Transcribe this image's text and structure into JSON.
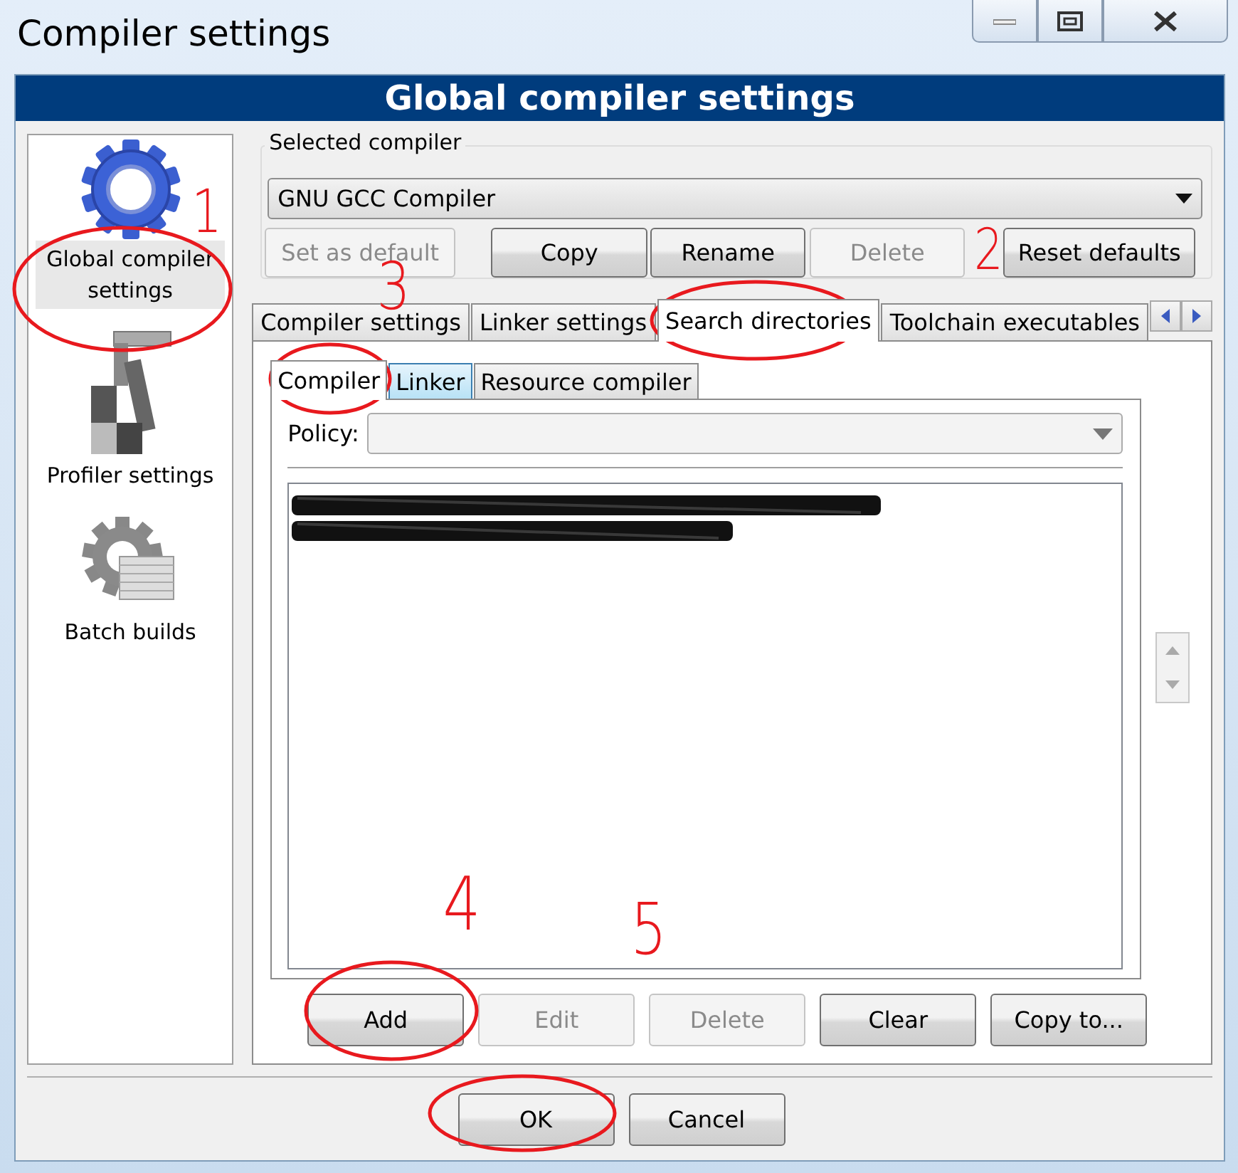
{
  "window": {
    "title": "Compiler settings"
  },
  "header": "Global compiler settings",
  "sidebar": {
    "items": [
      {
        "label": "Global compiler settings",
        "kind": "gear",
        "selected": true
      },
      {
        "label": "Profiler settings",
        "kind": "profiler",
        "selected": false
      },
      {
        "label": "Batch builds",
        "kind": "batch",
        "selected": false
      }
    ]
  },
  "selected_compiler": {
    "label": "Selected compiler",
    "value": "GNU GCC Compiler"
  },
  "compiler_buttons": [
    {
      "label": "Set as default",
      "disabled": true
    },
    {
      "label": "Copy",
      "disabled": false
    },
    {
      "label": "Rename",
      "disabled": false
    },
    {
      "label": "Delete",
      "disabled": true
    },
    {
      "label": "Reset defaults",
      "disabled": false
    }
  ],
  "tabs": [
    {
      "label": "Compiler settings",
      "selected": false
    },
    {
      "label": "Linker settings",
      "selected": false
    },
    {
      "label": "Search directories",
      "selected": true
    },
    {
      "label": "Toolchain executables",
      "selected": false
    }
  ],
  "subtabs": [
    {
      "label": "Compiler",
      "selected": true,
      "hovered": false
    },
    {
      "label": "Linker",
      "selected": false,
      "hovered": true
    },
    {
      "label": "Resource compiler",
      "selected": false,
      "hovered": false
    }
  ],
  "policy": {
    "label": "Policy:"
  },
  "directories": [
    {
      "redacted": true
    },
    {
      "redacted": true
    }
  ],
  "list_buttons": [
    {
      "label": "Add",
      "disabled": false
    },
    {
      "label": "Edit",
      "disabled": true
    },
    {
      "label": "Delete",
      "disabled": true
    },
    {
      "label": "Clear",
      "disabled": false
    },
    {
      "label": "Copy to...",
      "disabled": false
    }
  ],
  "dialog_buttons": [
    {
      "label": "OK"
    },
    {
      "label": "Cancel"
    }
  ],
  "annotations": [
    {
      "text": "1"
    },
    {
      "text": "2"
    },
    {
      "text": "3"
    },
    {
      "text": "4"
    },
    {
      "text": "5"
    }
  ]
}
